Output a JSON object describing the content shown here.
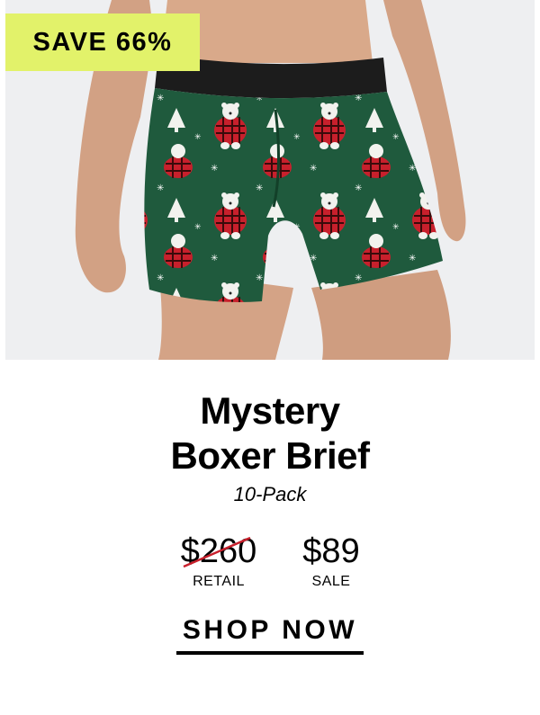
{
  "badge": {
    "text": "SAVE 66%"
  },
  "product": {
    "title_line1": "Mystery",
    "title_line2": "Boxer Brief",
    "pack": "10-Pack"
  },
  "pricing": {
    "retail_amount": "$260",
    "retail_label": "RETAIL",
    "sale_amount": "$89",
    "sale_label": "SALE"
  },
  "cta": {
    "label": "SHOP NOW"
  },
  "colors": {
    "badge_bg": "#e2f26a",
    "hero_bg": "#eeeff1",
    "fabric_green": "#1f5a3d",
    "plaid_red": "#c8202c",
    "strike": "#c8202c"
  }
}
